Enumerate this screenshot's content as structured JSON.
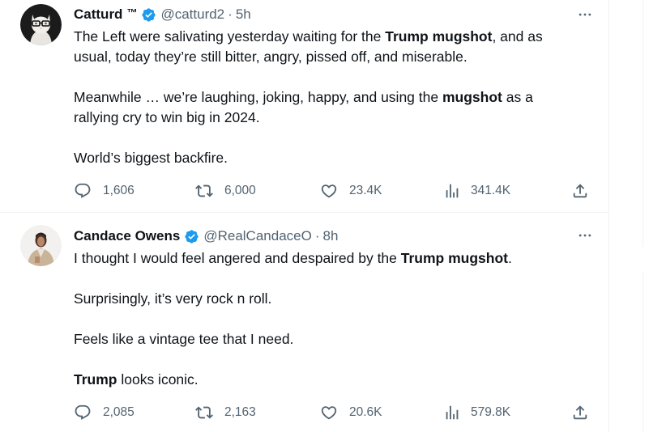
{
  "tweets": [
    {
      "name": "Catturd",
      "name_suffix": "™",
      "handle": "@catturd2",
      "separator": "·",
      "time": "5h",
      "lines": [
        [
          {
            "t": "The Left were salivating yesterday waiting for the "
          },
          {
            "t": "Trump mugshot",
            "b": true
          },
          {
            "t": ", and as"
          }
        ],
        [
          {
            "t": "usual, today they’re still bitter, angry, pissed off, and miserable."
          }
        ],
        [],
        [
          {
            "t": "Meanwhile … we’re laughing, joking, happy, and using the "
          },
          {
            "t": "mugshot",
            "b": true
          },
          {
            "t": " as a"
          }
        ],
        [
          {
            "t": "rallying cry to win big in 2024."
          }
        ],
        [],
        [
          {
            "t": "World’s biggest backfire."
          }
        ]
      ],
      "stats": {
        "replies": "1,606",
        "retweets": "6,000",
        "likes": "23.4K",
        "views": "341.4K"
      }
    },
    {
      "name": "Candace Owens",
      "name_suffix": "",
      "handle": "@RealCandaceO",
      "separator": "·",
      "time": "8h",
      "lines": [
        [
          {
            "t": "I thought I would feel angered and despaired by the "
          },
          {
            "t": "Trump mugshot",
            "b": true
          },
          {
            "t": "."
          }
        ],
        [],
        [
          {
            "t": "Surprisingly, it’s very rock n roll."
          }
        ],
        [],
        [
          {
            "t": "Feels like a vintage tee that I need."
          }
        ],
        [],
        [
          {
            "t": "Trump",
            "b": true
          },
          {
            "t": " looks iconic."
          }
        ]
      ],
      "stats": {
        "replies": "2,085",
        "retweets": "2,163",
        "likes": "20.6K",
        "views": "579.8K"
      }
    }
  ],
  "icons": {
    "verified": "verified-badge-icon",
    "more": "more-options-icon",
    "reply": "reply-icon",
    "retweet": "retweet-icon",
    "like": "heart-icon",
    "views": "views-chart-icon",
    "share": "share-icon"
  },
  "colors": {
    "verified": "#1d9bf0",
    "text": "#0f1419",
    "secondary": "#536471",
    "divider": "#eff3f4"
  }
}
